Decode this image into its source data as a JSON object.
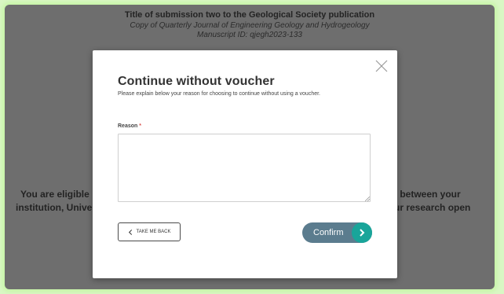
{
  "background": {
    "title": "Title of submission two to the Geological Society publication",
    "subtitle": "Copy of Quarterly Journal of Engineering Geology and Hydrogeology",
    "manuscript_id": "Manuscript ID: qjegh2023-133",
    "left_line_1": "You are eligible",
    "left_line_2": "institution, Unive",
    "right_line_1": "t between your",
    "right_line_2": "ur research open"
  },
  "modal": {
    "title": "Continue without voucher",
    "description": "Please explain below your reason for choosing to continue without using a voucher.",
    "reason_label": "Reason",
    "required_marker": "*",
    "reason_value": "",
    "back_label": "TAKE ME BACK",
    "confirm_label": "Confirm"
  },
  "icons": {
    "close": "close-icon",
    "back": "chevron-left-icon",
    "confirm": "chevron-right-icon"
  },
  "colors": {
    "overlay": "#6e6e6e",
    "page_border": "#d9f7c4",
    "confirm_button": "#5b7c8e",
    "confirm_arrow": "#19a59a",
    "required": "#d9534f"
  }
}
